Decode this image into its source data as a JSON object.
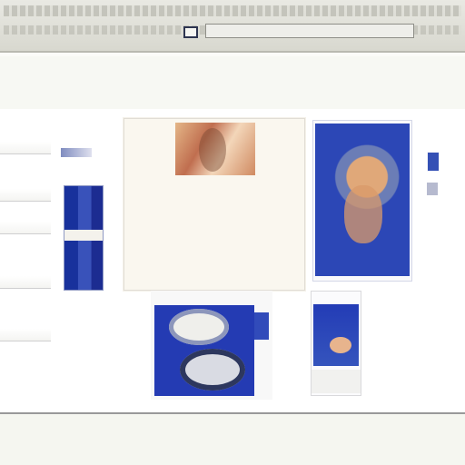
{
  "browser": {
    "title": "",
    "toolbar_text": "",
    "url": ""
  },
  "nav": {
    "left_a": "",
    "left_b": "",
    "center": "",
    "right_a": "",
    "right_b": ""
  },
  "sidebar": {
    "items": [
      {
        "label": ""
      },
      {
        "label": ""
      },
      {
        "label": ""
      },
      {
        "label": ""
      },
      {
        "label": ""
      }
    ]
  },
  "article": {
    "title": "",
    "text_lines": [
      "",
      "",
      "",
      "",
      ""
    ],
    "quote": ""
  },
  "promo": {
    "caption": ""
  },
  "lower_links": [
    "",
    ""
  ],
  "footer": {
    "links": [
      "",
      "",
      "",
      "",
      "",
      ""
    ]
  },
  "icons": {
    "window": "window-icon",
    "badge": "badge-icon",
    "bullet": "bullet-icon"
  },
  "colors": {
    "brand_blue": "#2a3272",
    "photo_blue": "#243bb3",
    "page_background": "#fbfbf8"
  }
}
